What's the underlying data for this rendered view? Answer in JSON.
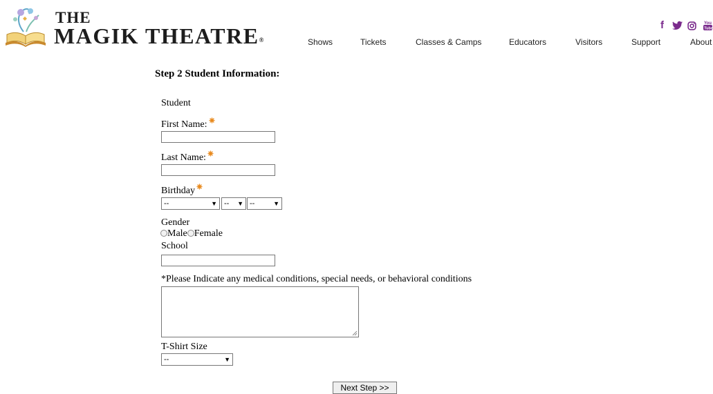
{
  "header": {
    "logo": {
      "the": "THE",
      "name": "MAGIK THEATRE",
      "reg": "®"
    },
    "nav": [
      {
        "label": "Shows"
      },
      {
        "label": "Tickets"
      },
      {
        "label": "Classes & Camps"
      },
      {
        "label": "Educators"
      },
      {
        "label": "Visitors"
      },
      {
        "label": "Support"
      },
      {
        "label": "About"
      }
    ],
    "social": [
      {
        "icon": "facebook-icon",
        "glyph": "f"
      },
      {
        "icon": "twitter-icon",
        "glyph": "🐦"
      },
      {
        "icon": "instagram-icon",
        "glyph": "◎"
      },
      {
        "icon": "youtube-icon",
        "glyph": "You Tube"
      }
    ],
    "brand_color": "#7a2a8c"
  },
  "form": {
    "step_title": "Step 2 Student Information:",
    "section_label": "Student",
    "first_name": {
      "label": "First Name:",
      "value": ""
    },
    "last_name": {
      "label": "Last Name:",
      "value": ""
    },
    "birthday": {
      "label": "Birthday",
      "month": "--",
      "day": "--",
      "year": "--"
    },
    "gender": {
      "label": "Gender",
      "options": [
        "Male",
        "Female"
      ]
    },
    "school": {
      "label": "School",
      "value": ""
    },
    "medical": {
      "label": "*Please Indicate any medical conditions, special needs, or behavioral conditions",
      "value": ""
    },
    "tshirt": {
      "label": "T-Shirt Size",
      "value": "--"
    },
    "next_button": "Next Step >>",
    "required_color": "#e8891c"
  }
}
